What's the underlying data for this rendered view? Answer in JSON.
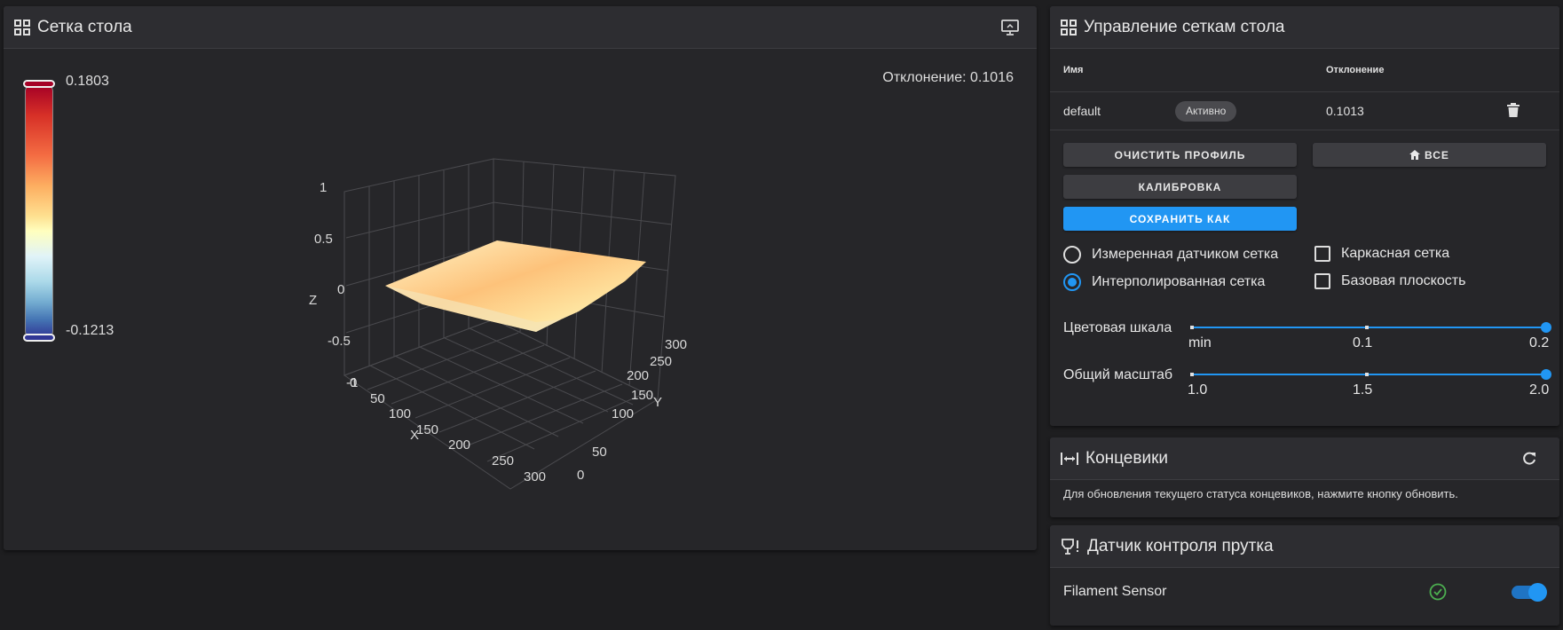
{
  "mesh": {
    "title": "Сетка стола",
    "deviation_label": "Отклонение: 0.1016",
    "scale_max": "0.1803",
    "scale_min": "-0.1213",
    "z_ticks": [
      "1",
      "0.5",
      "0",
      "-0.5",
      "-1"
    ],
    "x_ticks": [
      "0",
      "50",
      "100",
      "150",
      "200",
      "250",
      "300"
    ],
    "y_ticks": [
      "0",
      "50",
      "100",
      "150",
      "200",
      "250",
      "300"
    ],
    "x_axis": "X",
    "y_axis": "Y",
    "z_axis": "Z"
  },
  "management": {
    "title": "Управление сеткам стола",
    "col_name": "Имя",
    "col_deviation": "Отклонение",
    "row": {
      "name": "default",
      "status": "Активно",
      "deviation": "0.1013"
    },
    "btn_clear": "ОЧИСТИТЬ ПРОФИЛЬ",
    "btn_home_all": "ВСЕ",
    "btn_calibrate": "КАЛИБРОВКА",
    "btn_save_as": "СОХРАНИТЬ КАК",
    "radio_probed": "Измеренная датчиком сетка",
    "radio_interpolated": "Интерполированная сетка",
    "check_wireframe": "Каркасная сетка",
    "check_base_plane": "Базовая плоскость",
    "color_scale_label": "Цветовая шкала",
    "color_scale_ticks": [
      "min",
      "0.1",
      "0.2"
    ],
    "overall_scale_label": "Общий масштаб",
    "overall_scale_ticks": [
      "1.0",
      "1.5",
      "2.0"
    ],
    "selected_view": "interpolated",
    "color_scale_value": "0.2",
    "overall_scale_value": "2.0"
  },
  "endstops": {
    "title": "Концевики",
    "message": "Для обновления текущего статуса концевиков, нажмите кнопку обновить."
  },
  "filament": {
    "title": "Датчик контроля прутка",
    "sensor_name": "Filament Sensor",
    "enabled": true
  },
  "colors": {
    "accent": "#2196f3",
    "ok": "#4caf50"
  },
  "icons": [
    "grid-icon",
    "monitor-icon",
    "trash-icon",
    "home-icon",
    "endstop-icon",
    "refresh-icon",
    "filament-sensor-icon",
    "check-circle-icon"
  ]
}
